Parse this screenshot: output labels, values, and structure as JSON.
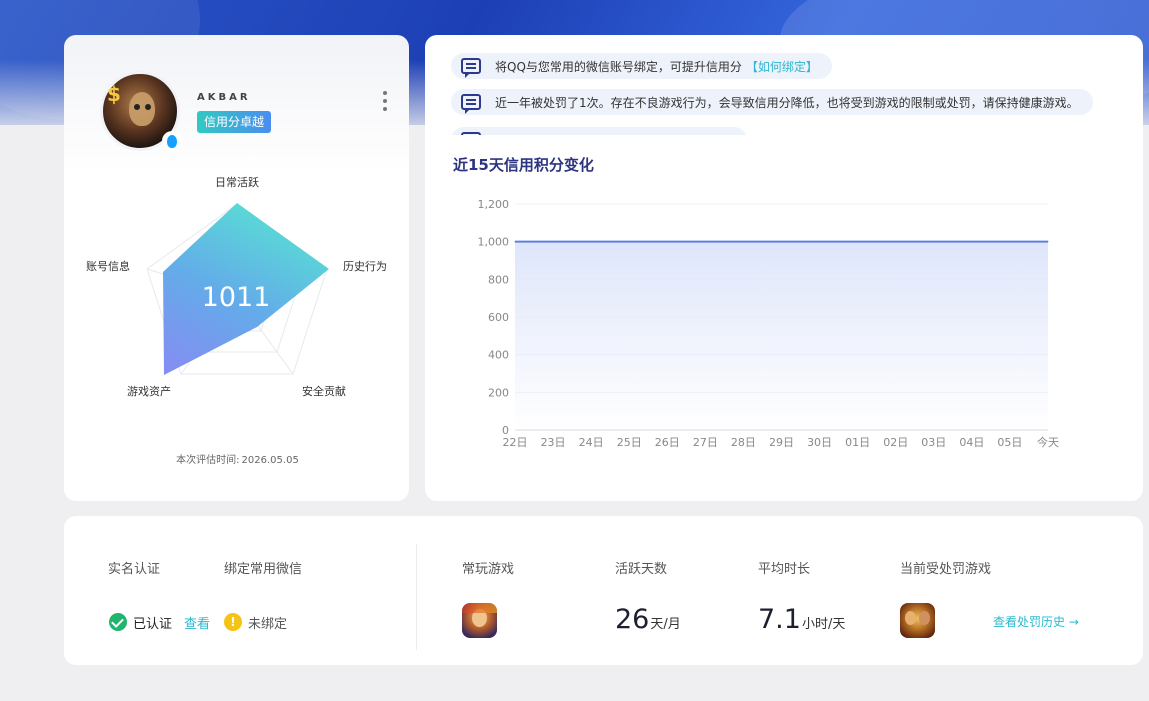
{
  "profile": {
    "username": "AKBAR",
    "credit_level": "信用分卓越",
    "score": "1011",
    "radar_labels": {
      "daily_activity": "日常活跃",
      "history_behavior": "历史行为",
      "security_contribution": "安全贡献",
      "game_assets": "游戏资产",
      "account_info": "账号信息"
    },
    "eval_time_label": "本次评估时间:",
    "eval_time_value": "2026.05.05"
  },
  "notices": [
    {
      "text": "将QQ与您常用的微信账号绑定，可提升信用分",
      "link": "【如何绑定】"
    },
    {
      "text": "近一年被处罚了1次。存在不良游戏行为，会导致信用分降低，也将受到游戏的限制或处罚，请保持健康游戏。",
      "link": ""
    }
  ],
  "chart_title": "近15天信用积分变化",
  "chart_data": {
    "type": "area",
    "title": "近15天信用积分变化",
    "categories": [
      "22日",
      "23日",
      "24日",
      "25日",
      "26日",
      "27日",
      "28日",
      "29日",
      "30日",
      "01日",
      "02日",
      "03日",
      "04日",
      "05日",
      "今天"
    ],
    "series": [
      {
        "values": [
          1000,
          1000,
          1000,
          1000,
          1000,
          1000,
          1000,
          1000,
          1000,
          1000,
          1000,
          1000,
          1000,
          1000,
          1000
        ]
      }
    ],
    "ylim": [
      0,
      1200
    ],
    "yticks": [
      "0",
      "200",
      "400",
      "600",
      "800",
      "1,000",
      "1,200"
    ],
    "grid": true,
    "line_color": "#5b80e0",
    "fill_color": "#dfe6fb"
  },
  "stats": {
    "real_name_label": "实名认证",
    "real_name_status": "已认证",
    "real_name_view": "查看",
    "wechat_label": "绑定常用微信",
    "wechat_status": "未绑定",
    "frequent_game_label": "常玩游戏",
    "active_days_label": "活跃天数",
    "active_days_value": "26",
    "active_days_unit": "天/月",
    "avg_duration_label": "平均时长",
    "avg_duration_value": "7.1",
    "avg_duration_unit": "小时/天",
    "punished_game_label": "当前受处罚游戏",
    "history_link": "查看处罚历史 →"
  },
  "colors": {
    "accent": "#2bb8d0",
    "title": "#2d3480",
    "success": "#1fb56d",
    "warning": "#f5c316"
  }
}
